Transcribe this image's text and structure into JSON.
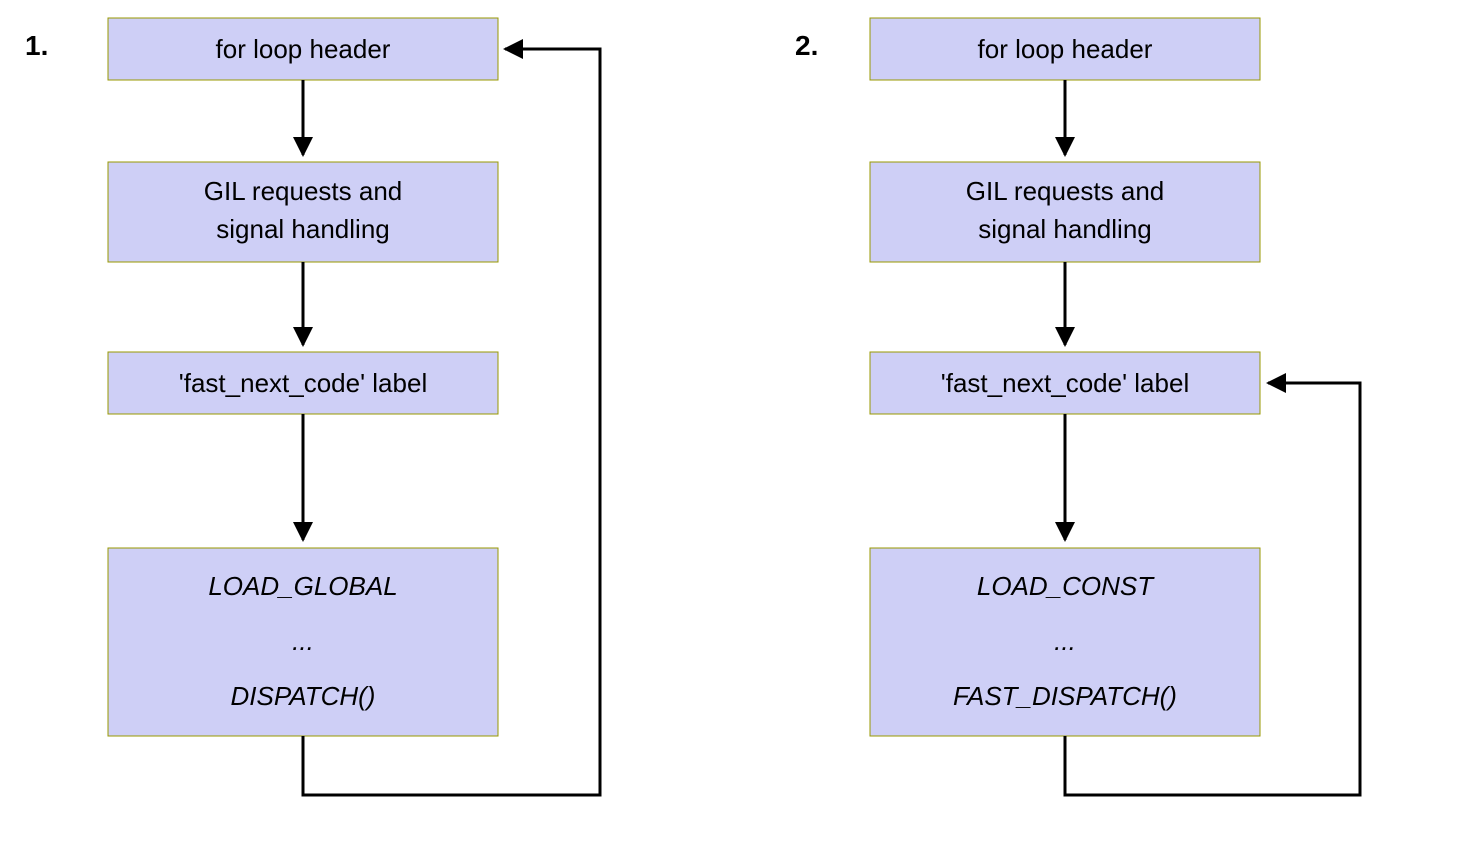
{
  "diagram": {
    "left": {
      "number": "1.",
      "nodes": {
        "n1": "for loop header",
        "n2a": "GIL requests and",
        "n2b": "signal handling",
        "n3": "'fast_next_code' label",
        "n4a": "LOAD_GLOBAL",
        "n4b": "...",
        "n4c": "DISPATCH()"
      }
    },
    "right": {
      "number": "2.",
      "nodes": {
        "n1": "for loop header",
        "n2a": "GIL requests and",
        "n2b": "signal handling",
        "n3": "'fast_next_code' label",
        "n4a": "LOAD_CONST",
        "n4b": "...",
        "n4c": "FAST_DISPATCH()"
      }
    }
  }
}
